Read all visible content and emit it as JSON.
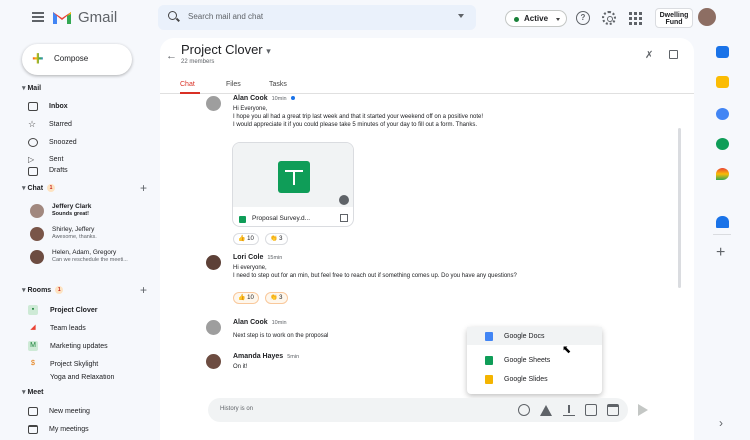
{
  "app": {
    "name": "Gmail"
  },
  "colors": {
    "accent": "#d93025",
    "online": "#1a73e8",
    "active_status": "#188038",
    "sheets": "#0f9d58",
    "docs": "#4285f4",
    "slides": "#f4b400"
  },
  "header": {
    "search_placeholder": "Search mail and chat",
    "status_label": "Active",
    "help_icon_glyph": "?",
    "brand_label": "Dwelling Fund"
  },
  "sidebar": {
    "compose_label": "Compose",
    "mail_section": "Mail",
    "mail_items": [
      {
        "label": "Inbox",
        "icon": "inbox-icon"
      },
      {
        "label": "Starred",
        "icon": "star-icon"
      },
      {
        "label": "Snoozed",
        "icon": "clock-icon"
      },
      {
        "label": "Sent",
        "icon": "send-icon"
      },
      {
        "label": "Drafts",
        "icon": "draft-icon"
      }
    ],
    "chat_section": "Chat",
    "chat_badge": "1",
    "chat_people": [
      {
        "name": "Jeffery Clark",
        "preview": "Sounds great!"
      },
      {
        "name": "Shirley, Jeffery",
        "preview": "Awesome, thanks."
      },
      {
        "name": "Helen, Adam, Gregory",
        "preview": "Can we reschedule the meeti..."
      }
    ],
    "rooms_section": "Rooms",
    "rooms_badge": "1",
    "rooms": [
      {
        "label": "Project Clover",
        "color": "#34a853"
      },
      {
        "label": "Team leads",
        "color": "#ea4335"
      },
      {
        "label": "Marketing updates",
        "letter": "M",
        "color": "#34a853"
      },
      {
        "label": "Project Skylight",
        "color": "#fbbc04"
      },
      {
        "label": "Yoga and Relaxation",
        "color": "#a142f4"
      }
    ],
    "meet_section": "Meet",
    "meet_items": [
      {
        "label": "New meeting",
        "icon": "video-icon"
      },
      {
        "label": "My meetings",
        "icon": "calendar-icon"
      }
    ]
  },
  "room": {
    "title": "Project Clover",
    "members": "22 members",
    "tabs": [
      "Chat",
      "Files",
      "Tasks"
    ]
  },
  "messages": [
    {
      "author": "Alan Cook",
      "time": "10min",
      "lines": [
        "Hi Everyone,",
        "I hope you all had a great trip last week and that it started your weekend off on a positive note!",
        "I would appreciate it if you could please take 5 minutes of your day to fill out a form. Thanks."
      ]
    },
    {
      "author": "Lori Cole",
      "time": "15min",
      "lines": [
        "Hi everyone,",
        "I need to step out for an min, but feel free to reach out if something comes up.  Do you have any questions?"
      ]
    },
    {
      "author": "Alan Cook",
      "time": "10min",
      "lines": [
        "Next step is to work on the proposal"
      ]
    },
    {
      "author": "Amanda Hayes",
      "time": "5min",
      "lines": [
        "On it!"
      ]
    }
  ],
  "attachment": {
    "name": "Proposal Survey.d..."
  },
  "reactions": {
    "first": [
      {
        "emoji": "👍",
        "count": "10"
      },
      {
        "emoji": "👏",
        "count": "3"
      }
    ],
    "second": [
      {
        "emoji": "👍",
        "count": "10"
      },
      {
        "emoji": "👏",
        "count": "3"
      }
    ]
  },
  "composer": {
    "hint": "History is on"
  },
  "attach_menu": [
    "Google Docs",
    "Google Sheets",
    "Google Slides"
  ]
}
